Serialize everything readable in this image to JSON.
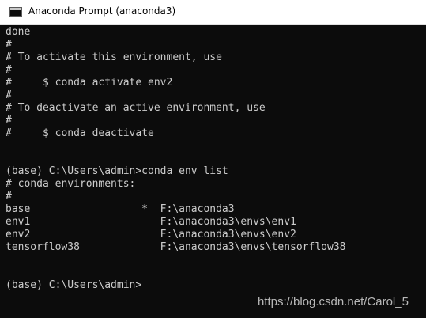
{
  "window": {
    "title": "Anaconda Prompt (anaconda3)",
    "title_icon": "console-icon"
  },
  "console": {
    "lines": [
      "done",
      "#",
      "# To activate this environment, use",
      "#",
      "#     $ conda activate env2",
      "#",
      "# To deactivate an active environment, use",
      "#",
      "#     $ conda deactivate",
      "",
      "",
      "(base) C:\\Users\\admin>conda env list",
      "# conda environments:",
      "#",
      "base                  *  F:\\anaconda3",
      "env1                     F:\\anaconda3\\envs\\env1",
      "env2                     F:\\anaconda3\\envs\\env2",
      "tensorflow38             F:\\anaconda3\\envs\\tensorflow38",
      "",
      "",
      "(base) C:\\Users\\admin>"
    ],
    "text_color": "#cccccc",
    "background": "#0c0c0c"
  },
  "watermark": "https://blog.csdn.net/Carol_5"
}
